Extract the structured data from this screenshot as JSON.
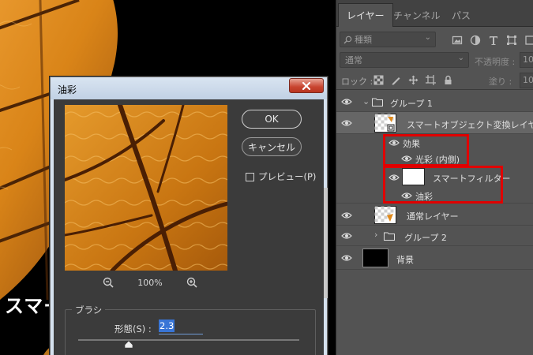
{
  "canvas": {
    "overlay_text": "スマー"
  },
  "dialog": {
    "title": "油彩",
    "ok_label": "OK",
    "cancel_label": "キャンセル",
    "preview_label": "プレビュー(P)",
    "preview_checked": false,
    "zoom_value": "100%",
    "brush_group_label": "ブラシ",
    "stylize_label": "形態(S) :",
    "stylize_value": "2.3",
    "stylize_slider_level": 0.23
  },
  "panel": {
    "tabs": [
      "レイヤー",
      "チャンネル",
      "パス"
    ],
    "active_tab": "レイヤー",
    "kind_filter": "種類",
    "blend_mode": "通常",
    "opacity_label": "不透明度 :",
    "opacity_value": "10",
    "lock_label": "ロック :",
    "fill_label": "塗り :",
    "fill_value": "10",
    "layers": [
      {
        "name": "グループ 1",
        "type": "group-expanded"
      },
      {
        "name": "スマートオブジェクト変換レイヤー",
        "type": "smart-object"
      },
      {
        "name": "効果",
        "type": "effects-header"
      },
      {
        "name": "光彩 (内側)",
        "type": "effect"
      },
      {
        "name": "スマートフィルター",
        "type": "smart-filter"
      },
      {
        "name": "油彩",
        "type": "filter"
      },
      {
        "name": "通常レイヤー",
        "type": "layer"
      },
      {
        "name": "グループ 2",
        "type": "group-collapsed"
      },
      {
        "name": "背景",
        "type": "background"
      }
    ]
  },
  "colors": {
    "highlight_box": "#e00000",
    "panel_bg": "#535353",
    "dialog_bg": "#3b3b3b",
    "selection_blue": "#3875d6"
  }
}
